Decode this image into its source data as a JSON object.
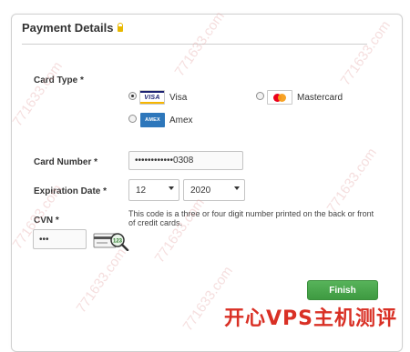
{
  "header": {
    "title": "Payment Details"
  },
  "card_type": {
    "label": "Card Type *",
    "options": [
      {
        "name": "Visa",
        "logo_text": "VISA",
        "checked": true
      },
      {
        "name": "Mastercard",
        "checked": false
      },
      {
        "name": "Amex",
        "logo_text": "AMEX",
        "checked": false
      }
    ]
  },
  "card_number": {
    "label": "Card Number *",
    "value": "••••••••••••0308"
  },
  "expiration": {
    "label": "Expiration Date *",
    "month": "12",
    "year": "2020"
  },
  "cvn": {
    "label": "CVN *",
    "value": "•••",
    "help_text": "This code is a three or four digit number printed on the back or front of credit cards.",
    "icon_code": "123"
  },
  "actions": {
    "finish_label": "Finish"
  },
  "watermark": {
    "text": "771633.com",
    "brand": "开心VPS主机测评"
  },
  "colors": {
    "finish_button": "#4aa94d",
    "lock": "#e8b800",
    "brand_red": "#d93025"
  }
}
